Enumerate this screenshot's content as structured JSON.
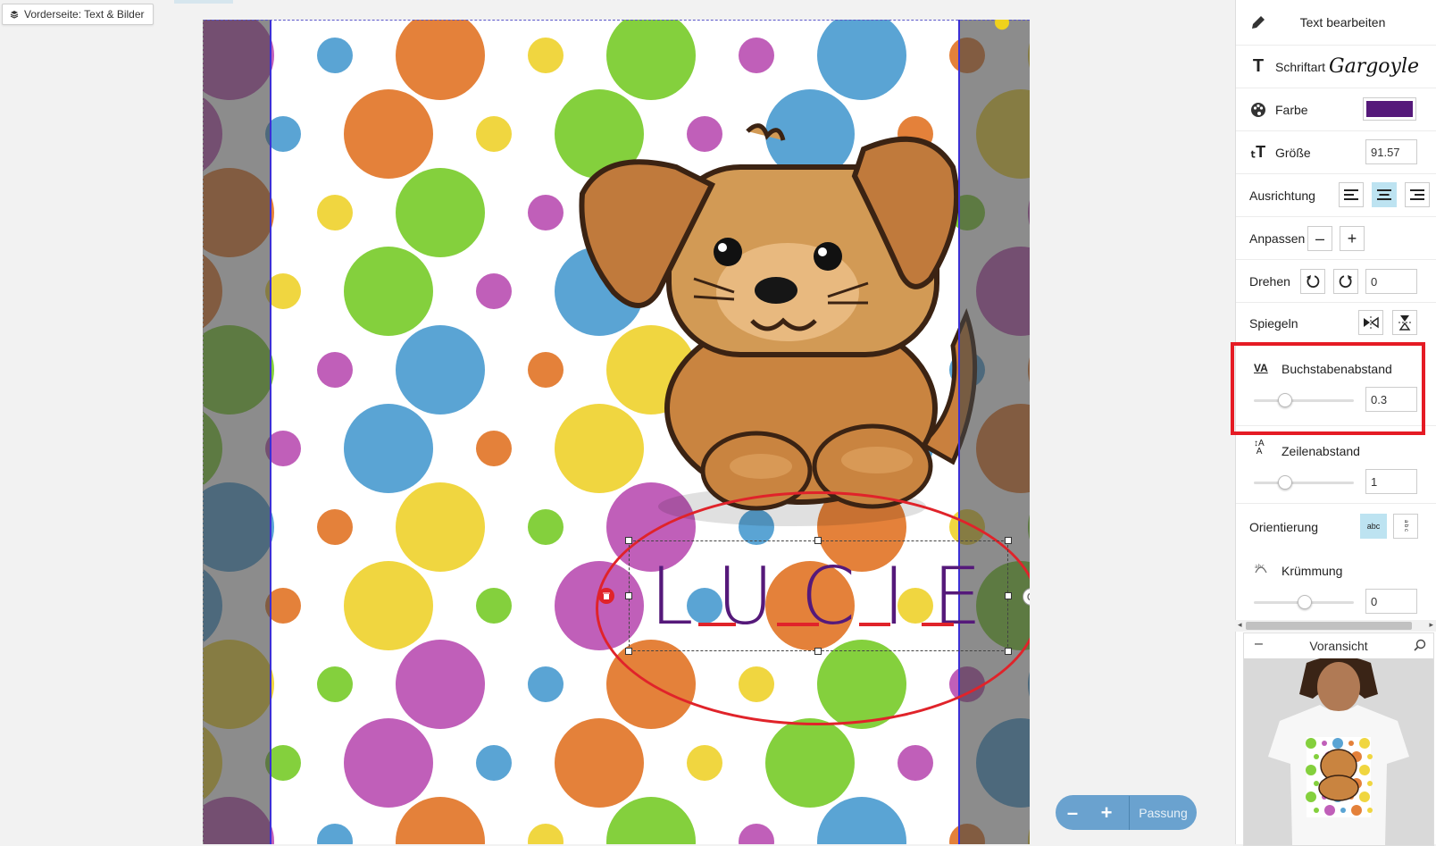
{
  "layer_tag": {
    "label": "Vorderseite: Text & Bilder"
  },
  "canvas": {
    "name_text": "LUCIE",
    "text_color": "#55197a",
    "annotation_color": "#e0232a",
    "dot_colors": [
      "#84d03d",
      "#c05fb9",
      "#5aa4d4",
      "#e4813a",
      "#f0d640"
    ]
  },
  "zoom": {
    "minus": "–",
    "plus": "+",
    "fit_label": "Passung"
  },
  "panel": {
    "title": "Text bearbeiten",
    "font": {
      "label": "Schriftart",
      "value": "Gargoyle"
    },
    "color": {
      "label": "Farbe",
      "value": "#55197a"
    },
    "size": {
      "label": "Größe",
      "value": "91.57"
    },
    "align": {
      "label": "Ausrichtung",
      "active": "center"
    },
    "fit": {
      "label": "Anpassen",
      "minus": "–",
      "plus": "+"
    },
    "rotate": {
      "label": "Drehen",
      "value": "0"
    },
    "mirror": {
      "label": "Spiegeln"
    },
    "letter_spacing": {
      "label": "Buchstabenabstand",
      "value": "0.3",
      "slider_fraction": 0.3
    },
    "line_spacing": {
      "label": "Zeilenabstand",
      "value": "1",
      "slider_fraction": 0.3
    },
    "orientation": {
      "label": "Orientierung",
      "horizontal": "abc",
      "vertical": "a b c"
    },
    "curvature": {
      "label": "Krümmung",
      "value": "0",
      "slider_fraction": 0.5
    }
  },
  "preview": {
    "title": "Voransicht",
    "collapse": "–"
  },
  "icons": {
    "layer": "layers-icon",
    "edit": "pencil-icon",
    "font": "font-T-icon",
    "palette": "palette-icon",
    "size": "text-size-icon",
    "spacing": "letter-spacing-icon",
    "line_spacing": "line-spacing-icon",
    "curve": "curvature-icon",
    "search": "magnifier-icon"
  }
}
